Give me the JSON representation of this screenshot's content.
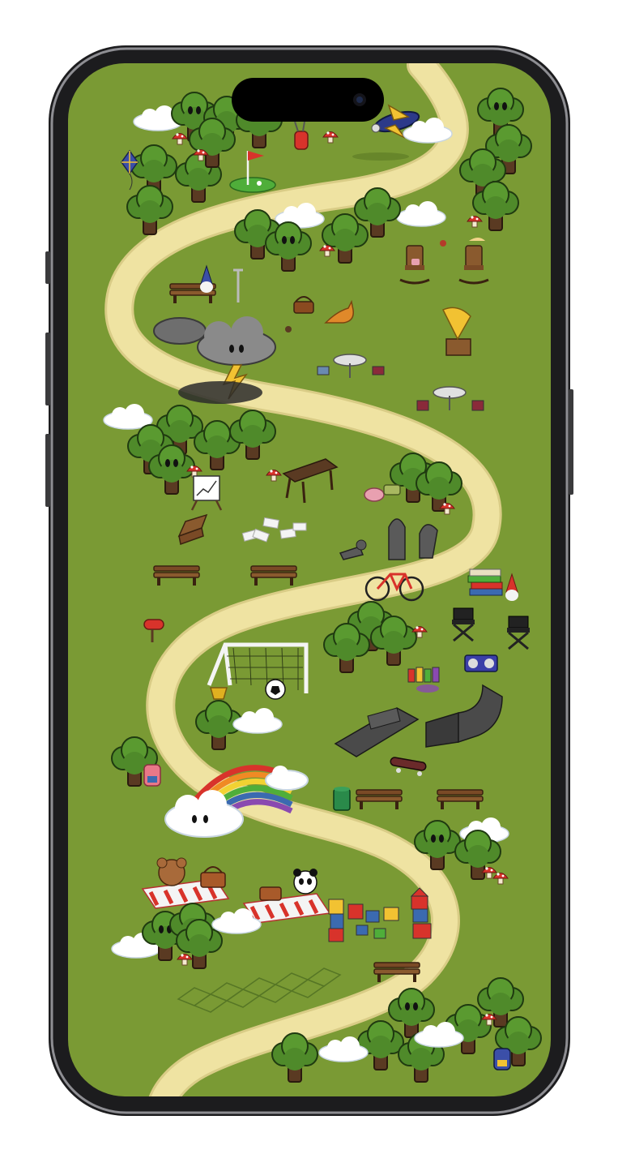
{
  "device": {
    "frame_color": "#1c1c1e",
    "bezel_color": "#8e8e93",
    "island_color": "#000000"
  },
  "map": {
    "grass_color": "#7a9a34",
    "path_color": "#efe3a2",
    "path_edge_color": "#d9cc86",
    "tree_foliage": "#4f8a2a",
    "tree_trunk": "#5a3a22",
    "landmarks": [
      {
        "name": "golf-flag",
        "icon": "flag-icon"
      },
      {
        "name": "airplane",
        "icon": "airplane-icon"
      },
      {
        "name": "kite",
        "icon": "kite-icon"
      },
      {
        "name": "storm-cloud",
        "icon": "storm-cloud-icon"
      },
      {
        "name": "rocking-chairs",
        "icon": "rocking-chair-icon"
      },
      {
        "name": "gramophone",
        "icon": "gramophone-icon"
      },
      {
        "name": "cafe-tables",
        "icon": "table-icon"
      },
      {
        "name": "picnic-table",
        "icon": "picnic-table-icon"
      },
      {
        "name": "easel-chart",
        "icon": "easel-icon"
      },
      {
        "name": "chess-pieces",
        "icon": "chess-icon"
      },
      {
        "name": "bicycle",
        "icon": "bicycle-icon"
      },
      {
        "name": "book-stack",
        "icon": "books-icon"
      },
      {
        "name": "soccer-goal",
        "icon": "goal-icon"
      },
      {
        "name": "trophy",
        "icon": "trophy-icon"
      },
      {
        "name": "skate-ramps",
        "icon": "ramp-icon"
      },
      {
        "name": "skateboard",
        "icon": "skateboard-icon"
      },
      {
        "name": "boombox",
        "icon": "boombox-icon"
      },
      {
        "name": "rainbow",
        "icon": "rainbow-icon"
      },
      {
        "name": "teddy-bear-picnic",
        "icon": "bear-icon"
      },
      {
        "name": "panda-picnic",
        "icon": "panda-icon"
      },
      {
        "name": "toy-blocks",
        "icon": "blocks-icon"
      },
      {
        "name": "hopscotch",
        "icon": "hopscotch-icon"
      },
      {
        "name": "backpack",
        "icon": "backpack-icon"
      },
      {
        "name": "mailbox",
        "icon": "mailbox-icon"
      },
      {
        "name": "garden-gnome",
        "icon": "gnome-icon"
      }
    ]
  }
}
